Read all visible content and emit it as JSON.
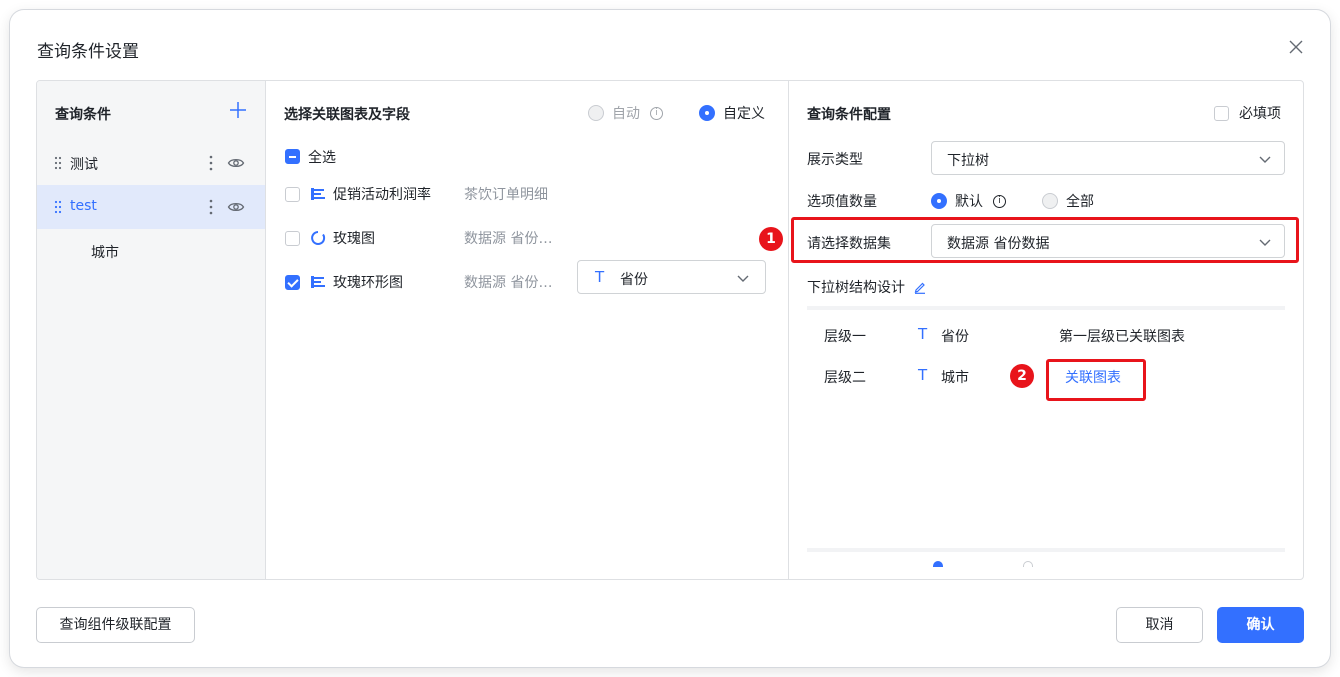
{
  "dialog": {
    "title": "查询条件设置"
  },
  "left_panel": {
    "title": "查询条件",
    "conditions": [
      {
        "label": "测试",
        "active": false
      },
      {
        "label": "test",
        "active": true
      }
    ],
    "sub_item": "城市"
  },
  "middle_panel": {
    "title": "选择关联图表及字段",
    "mode_auto": "自动",
    "mode_custom": "自定义",
    "select_all": "全选",
    "charts": [
      {
        "name": "促销活动利润率",
        "source": "茶饮订单明细",
        "checked": false,
        "icon": "bar-chart-icon"
      },
      {
        "name": "玫瑰图",
        "source": "数据源 省份…",
        "checked": false,
        "icon": "ring-chart-icon"
      },
      {
        "name": "玫瑰环形图",
        "source": "数据源 省份…",
        "checked": true,
        "icon": "bar-chart-icon",
        "field": {
          "type_glyph": "T",
          "value": "省份"
        }
      }
    ]
  },
  "right_panel": {
    "title": "查询条件配置",
    "required_label": "必填项",
    "display_type_label": "展示类型",
    "display_type_value": "下拉树",
    "option_count_label": "选项值数量",
    "option_default": "默认",
    "option_all": "全部",
    "dataset_label": "请选择数据集",
    "dataset_value": "数据源 省份数据",
    "tree_design_label": "下拉树结构设计",
    "levels": [
      {
        "name": "层级一",
        "type_glyph": "T",
        "field": "省份",
        "status": "第一层级已关联图表"
      },
      {
        "name": "层级二",
        "type_glyph": "T",
        "field": "城市",
        "link": "关联图表"
      }
    ],
    "callout_badges": [
      "1",
      "2"
    ]
  },
  "footer": {
    "cascade_button": "查询组件级联配置",
    "cancel_button": "取消",
    "confirm_button": "确认"
  },
  "colors": {
    "primary": "#3370ff",
    "callout_red": "#e8141b",
    "panel_bg": "#f5f6f7",
    "active_item_bg": "#e1e9fb"
  }
}
